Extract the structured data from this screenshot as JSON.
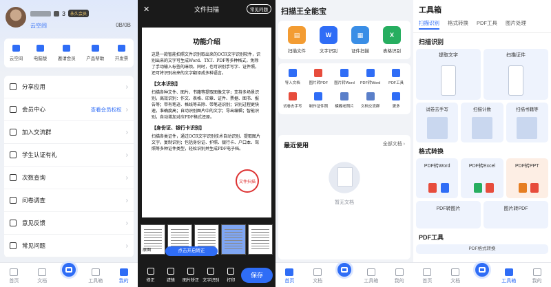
{
  "p1": {
    "user_suffix": "3",
    "vip": "永久会员",
    "points": "云空间",
    "storage": "0B/0B",
    "quick": [
      "云空间",
      "电脑版",
      "邀请会员",
      "产品帮助",
      "开发票"
    ],
    "menu": [
      {
        "label": "分享应用",
        "extra": ""
      },
      {
        "label": "会员中心",
        "extra": "查看会员权权"
      },
      {
        "label": "加入交流群",
        "extra": ""
      },
      {
        "label": "学生认证有礼",
        "extra": ""
      },
      {
        "label": "次数查询",
        "extra": ""
      },
      {
        "label": "问卷调查",
        "extra": ""
      },
      {
        "label": "意见反馈",
        "extra": ""
      },
      {
        "label": "常见问题",
        "extra": ""
      }
    ]
  },
  "tabs": [
    "首页",
    "文档",
    "",
    "工具箱",
    "我的"
  ],
  "p2": {
    "title": "文件扫描",
    "help": "常见问题",
    "doc_title": "功能介绍",
    "doc_intro": "这是一款智能拍照文件识别取出来的OCR文字识别软件，识别出来的文字可生成Word、TXT、PDF等多种格式，免除了手动输入标签的麻烦。同时，也可识别手写字、证件照，还可将识别出来的文字翻译成多种语言。",
    "sec1": "【文本识别】",
    "sec1_text": "扫描各种文件、图片、书籍等提取图像文字；支持多场景识别，高效识别：作文、表格、印章、证件、票据、图书、报告等；带有笔迹、格线等去除、带笔迹识别；识别过程更快速，准确度高；自动识别图片中的文字；导出编辑；智能识别，自动增加对应PDF格式还原。",
    "sec2": "【身份证、银行卡识别】",
    "sec2_text": "扫描各类证件，通过OCR文字识别技术自动识别、提取图片文字，复制识别；包括身份证、护照、银行卡、户口本、驾照等多种证件类型，轻松识别并生成PDF电子档。",
    "stamp": "文件扫描",
    "thumb_label": "原图",
    "correct": "点击开启矫正",
    "tools": [
      "修正",
      "滤镜",
      "图片矫正",
      "文字识别",
      "打印"
    ],
    "save": "保存"
  },
  "p3": {
    "title": "扫描王全能宝",
    "big": [
      {
        "label": "扫描文件",
        "color": "#f39c32",
        "glyph": "▤"
      },
      {
        "label": "文字识别",
        "color": "#2f6df6",
        "glyph": "W"
      },
      {
        "label": "证件扫描",
        "color": "#3a8ee6",
        "glyph": "▦"
      },
      {
        "label": "表格识别",
        "color": "#27ae60",
        "glyph": "X"
      }
    ],
    "grid": [
      {
        "label": "导入文档",
        "color": "#2f6df6"
      },
      {
        "label": "图片转PDF",
        "color": "#e74c3c"
      },
      {
        "label": "图片转Word",
        "color": "#2f6df6"
      },
      {
        "label": "PDF转Word",
        "color": "#2f6df6"
      },
      {
        "label": "PDF工具",
        "color": "#2f6df6"
      },
      {
        "label": "试卷去手写",
        "color": "#e74c3c"
      },
      {
        "label": "制作证件照",
        "color": "#2f6df6"
      },
      {
        "label": "模糊老照片",
        "color": "#5a7fc9"
      },
      {
        "label": "文档交流群",
        "color": "#5a7fc9"
      },
      {
        "label": "更多",
        "color": "#2f6df6"
      }
    ],
    "recent": "最近使用",
    "all_docs": "全部文档 ›",
    "empty": "暂无文档"
  },
  "p4": {
    "title": "工具箱",
    "tabs": [
      "扫描识别",
      "格式转换",
      "PDF工具",
      "图片处理"
    ],
    "sect1": "扫描识别",
    "cards1": [
      "提取文字",
      "扫描证件"
    ],
    "cards2": [
      "试卷去手写",
      "扫描计数",
      "扫描书籍等"
    ],
    "sect2": "格式转换",
    "cards3": [
      "PDF转Word",
      "PDF转Excel",
      "PDF转PPT"
    ],
    "cards4": [
      "PDF转图片",
      "图片转PDF"
    ],
    "sect3": "PDF工具",
    "cut": "PDF格式转换"
  }
}
